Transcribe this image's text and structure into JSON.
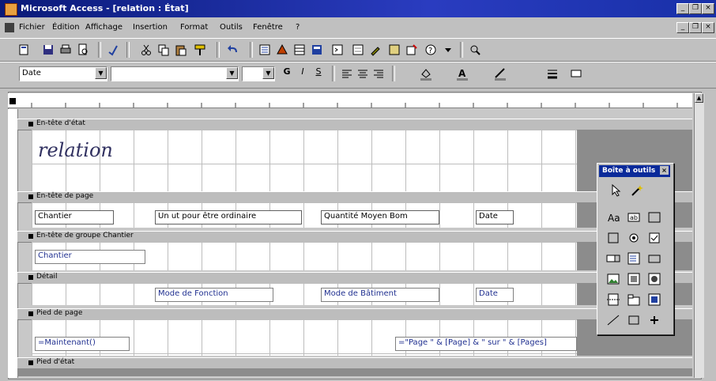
{
  "window": {
    "title": "Microsoft Access - [relation : État]",
    "minimize": "_",
    "restore": "❐",
    "close": "×"
  },
  "menu": {
    "items": [
      "Fichier",
      "Édition",
      "Affichage",
      "Insertion",
      "Format",
      "Outils",
      "Fenêtre",
      "?"
    ]
  },
  "formatbar": {
    "object_combo": "Date",
    "font_combo": "",
    "size_combo": ""
  },
  "report": {
    "sections": {
      "report_header": "En-tête d'état",
      "page_header": "En-tête de page",
      "group_header": "En-tête de groupe Chantier",
      "detail": "Détail",
      "page_footer": "Pied de page",
      "report_footer": "Pied d'état"
    },
    "title_label": "relation",
    "page_header_labels": [
      "Chantier",
      "Un ut pour être ordinaire",
      "Quantité Moyen Bom",
      "Date"
    ],
    "group_header_field": "Chantier",
    "detail_fields": [
      "Mode de Fonction",
      "Mode de Bâtiment",
      "Date"
    ],
    "page_footer_left": "=Maintenant()",
    "page_footer_right": "=\"Page \" & [Page] & \" sur \" & [Pages]"
  },
  "toolbox": {
    "title": "Boîte à outils"
  }
}
